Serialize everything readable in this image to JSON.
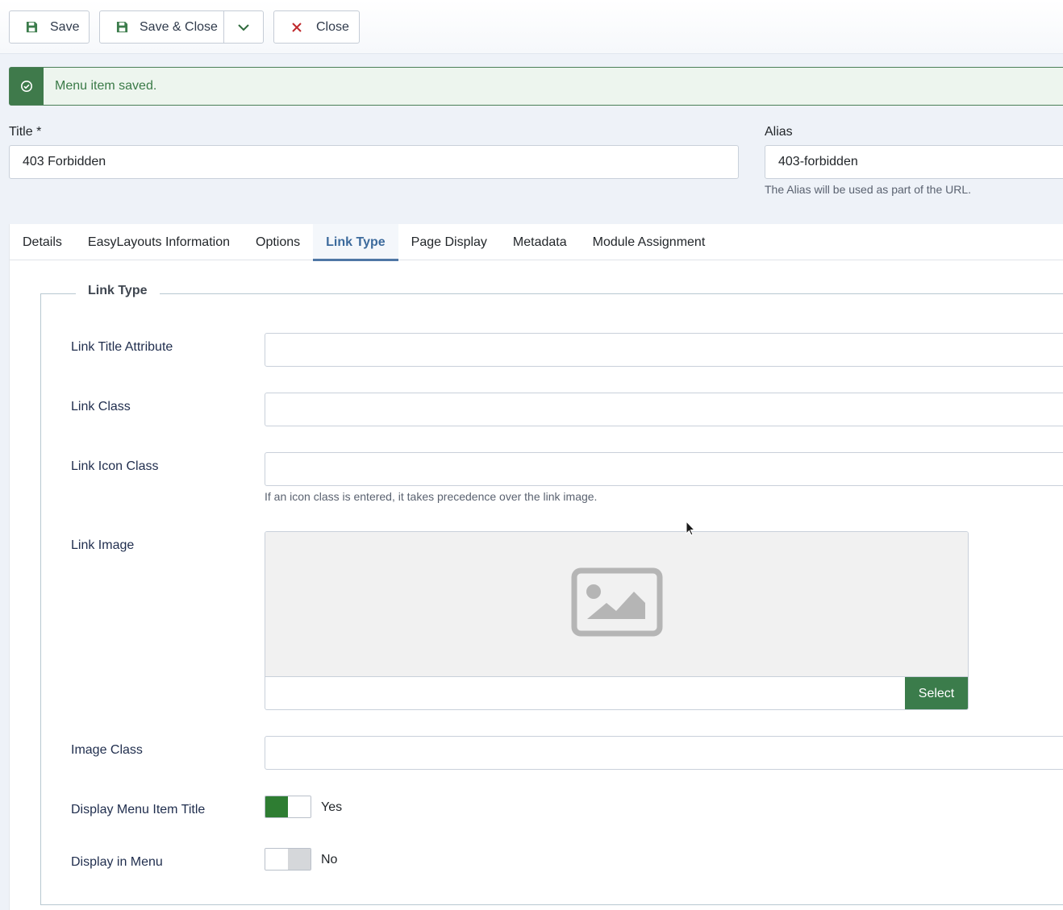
{
  "toolbar": {
    "save_label": "Save",
    "save_close_label": "Save & Close",
    "close_label": "Close"
  },
  "alert": {
    "message": "Menu item saved."
  },
  "form": {
    "title_label": "Title *",
    "title_value": "403 Forbidden",
    "alias_label": "Alias",
    "alias_value": "403-forbidden",
    "alias_hint": "The Alias will be used as part of the URL."
  },
  "tabs": [
    {
      "label": "Details"
    },
    {
      "label": "EasyLayouts Information"
    },
    {
      "label": "Options"
    },
    {
      "label": "Link Type",
      "active": true
    },
    {
      "label": "Page Display"
    },
    {
      "label": "Metadata"
    },
    {
      "label": "Module Assignment"
    }
  ],
  "link_type": {
    "legend": "Link Type",
    "link_title_attribute_label": "Link Title Attribute",
    "link_class_label": "Link Class",
    "link_icon_class_label": "Link Icon Class",
    "link_icon_class_hint": "If an icon class is entered, it takes precedence over the link image.",
    "link_image_label": "Link Image",
    "select_label": "Select",
    "image_class_label": "Image Class",
    "display_title_label": "Display Menu Item Title",
    "display_title_value": "Yes",
    "display_in_menu_label": "Display in Menu",
    "display_in_menu_value": "No"
  },
  "colors": {
    "accent_green": "#3b7c4b",
    "switch_on": "#2e7d32",
    "switch_off": "#d5d7da",
    "tab_active": "#3c6a9c"
  }
}
